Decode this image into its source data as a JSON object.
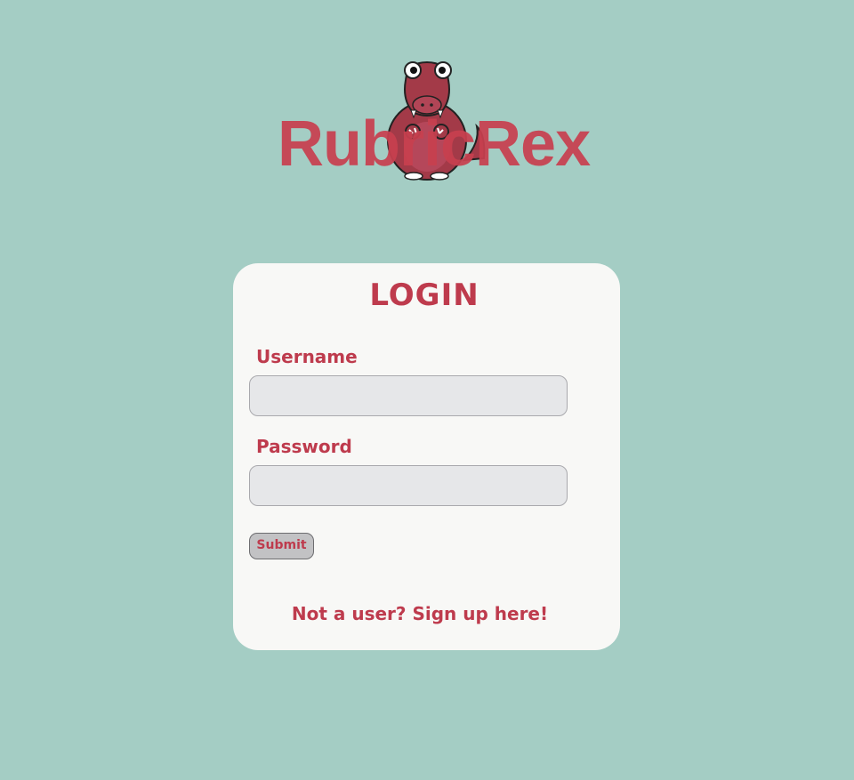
{
  "brand": {
    "logo_text": "RubricRex",
    "color": "#c8404f"
  },
  "login": {
    "title": "LOGIN",
    "username_label": "Username",
    "username_value": "",
    "password_label": "Password",
    "password_value": "",
    "submit_label": "Submit",
    "signup_link": "Not a user? Sign up here!"
  },
  "colors": {
    "background": "#a4cdc4",
    "card": "#f8f8f6",
    "accent": "#be3b4d",
    "field": "#e6e7e9",
    "button": "#c2c2c4"
  }
}
